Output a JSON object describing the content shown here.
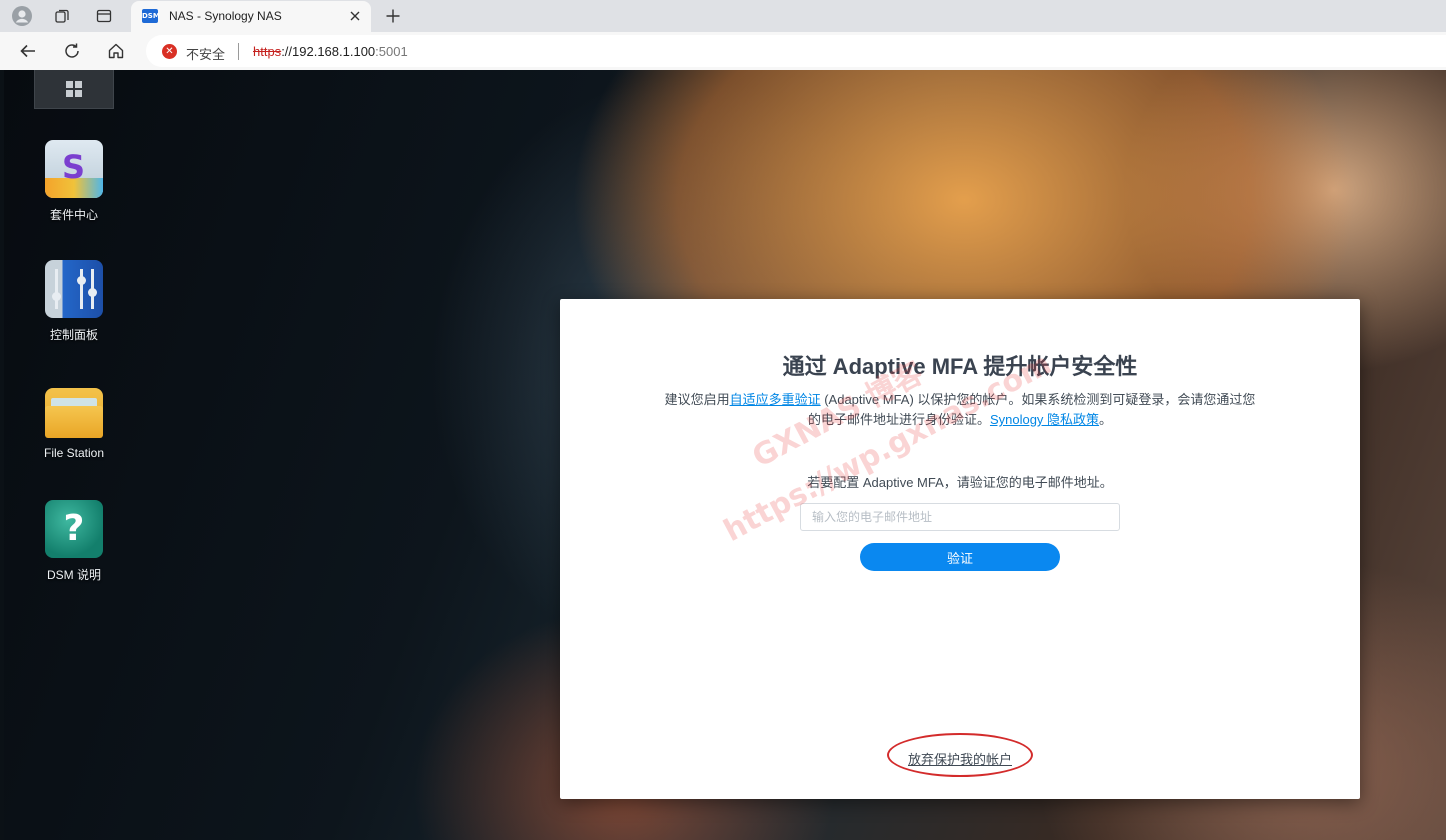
{
  "browser": {
    "tab": {
      "favicon_text": "DSM",
      "title": "NAS - Synology NAS"
    },
    "address": {
      "security_label": "不安全",
      "url_scheme": "https",
      "url_host": "://192.168.1.100",
      "url_port": ":5001"
    }
  },
  "desktop": {
    "icons": [
      {
        "label": "套件中心",
        "icon": "package-center-icon"
      },
      {
        "label": "控制面板",
        "icon": "control-panel-icon"
      },
      {
        "label": "File Station",
        "icon": "file-station-icon"
      },
      {
        "label": "DSM 说明",
        "icon": "dsm-help-icon"
      }
    ]
  },
  "dialog": {
    "title": "通过 Adaptive MFA 提升帐户安全性",
    "desc_prefix": "建议您启用",
    "desc_link": "自适应多重验证",
    "desc_middle": " (Adaptive MFA) 以保护您的帐户。如果系统检测到可疑登录，会请您通过您的电子邮件地址进行身份验证。",
    "privacy_link": "Synology 隐私政策",
    "desc_suffix": "。",
    "prompt": "若要配置 Adaptive MFA，请验证您的电子邮件地址。",
    "email_placeholder": "输入您的电子邮件地址",
    "verify_label": "验证",
    "giveup_label": "放弃保护我的帐户"
  },
  "watermark": {
    "line1": "GXNAS 博客",
    "line2": "https://wp.gxnas.com"
  },
  "colors": {
    "accent": "#0a88f0",
    "link": "#0086e5",
    "annotation": "#d32b2b",
    "insecure": "#d93025"
  }
}
